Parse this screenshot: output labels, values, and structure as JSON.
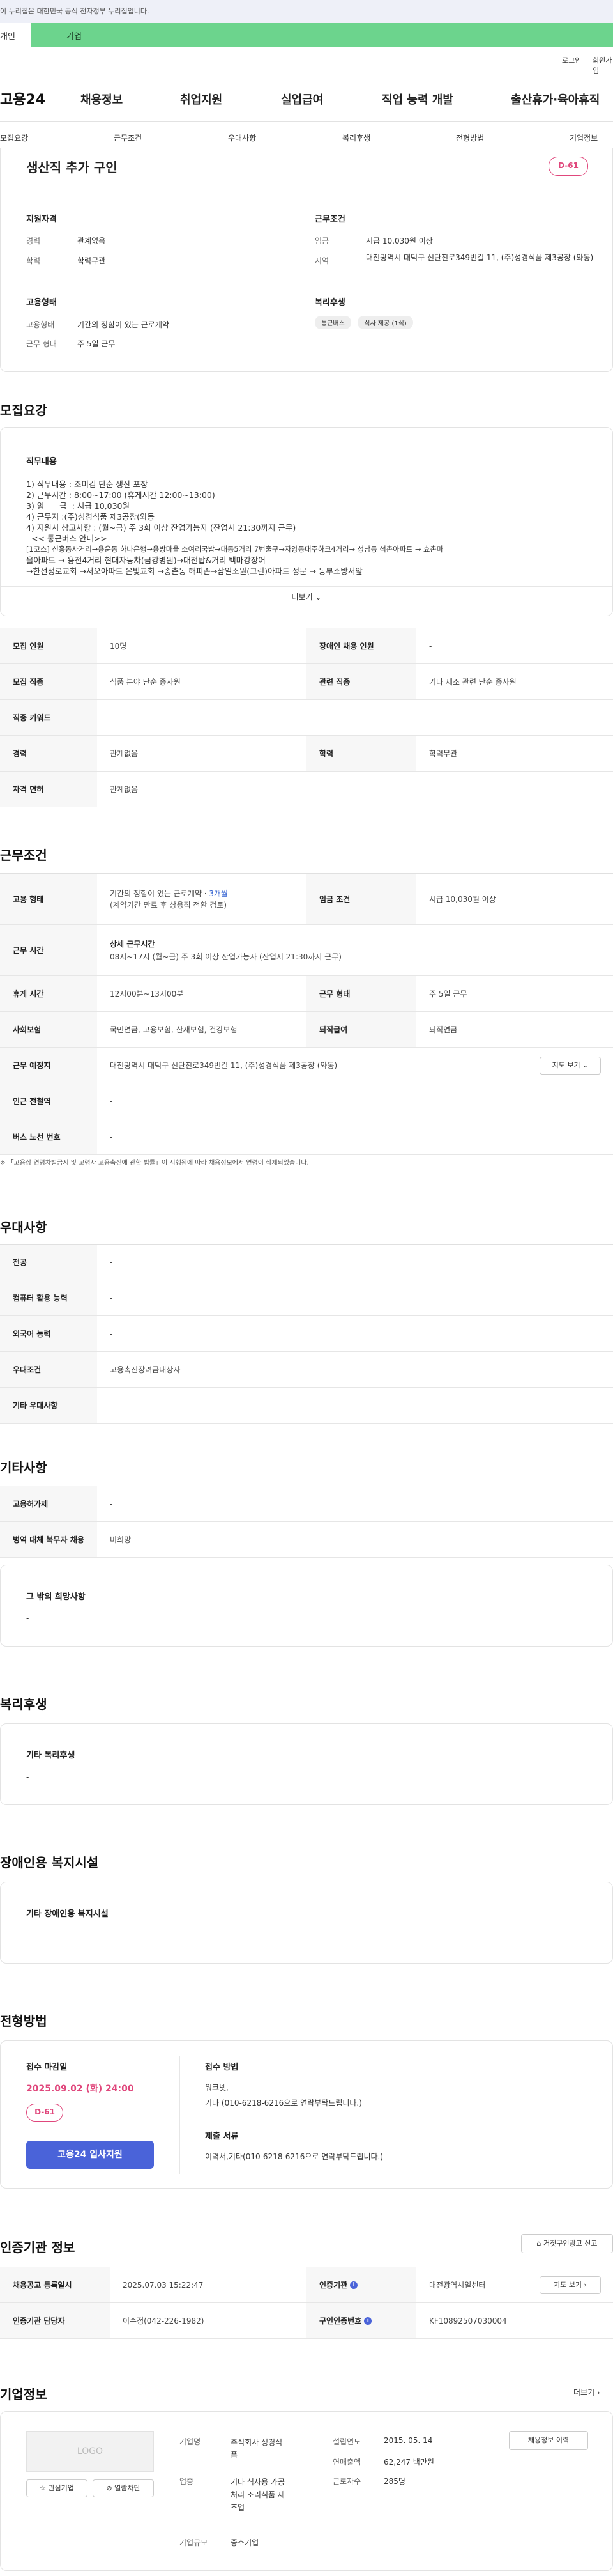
{
  "gov_banner": "이 누리집은 대한민국 공식 전자정부 누리집입니다.",
  "user_tabs": [
    "개인",
    "기업"
  ],
  "util_links": [
    "로그인",
    "회원가입"
  ],
  "logo": "고용24",
  "gnb": [
    "채용정보",
    "취업지원",
    "실업급여",
    "직업 능력 개발",
    "출산휴가·육아휴직"
  ],
  "subnav": [
    "모집요강",
    "근무조건",
    "우대사항",
    "복리후생",
    "전형방법",
    "기업정보"
  ],
  "job": {
    "title": "생산직 추가 구인",
    "dday": "D-61",
    "qual_title": "지원자격",
    "career_label": "경력",
    "career": "관계없음",
    "edu_label": "학력",
    "edu": "학력무관",
    "emp_title": "고용형태",
    "emptype_label": "고용형태",
    "emptype": "기간의 정함이 있는 근로계약",
    "week_label": "근무 형태",
    "week": "주 5일 근무",
    "cond_title": "근무조건",
    "wage_label": "임금",
    "wage": "시급 10,030원 이상",
    "region_label": "지역",
    "region": "대전광역시 대덕구 신탄진로349번길 11, (주)성경식품 제3공장 (와동)",
    "welfare_title": "복리후생",
    "welfare_chips": [
      "통근버스",
      "식사 제공 (1식)"
    ]
  },
  "recruit": {
    "title": "모집요강",
    "duty_title": "직무내용",
    "duty_lines": [
      "1) 직무내용 : 조미김 단순 생산 포장",
      "2) 근무시간 : 8:00~17:00 (휴게시간 12:00~13:00)",
      "3) 임      금  : 시급 10,030원",
      "4) 근무지 :(주)성경식품 제3공장(와동",
      "4) 지원시 참고사항 : (월~금) 주 3회 이상 잔업가능자 (잔업시 21:30까지 근무)",
      "  << 통근버스 안내>>",
      "[1코스] 신흥동사거리→용운동 하나은행→용방마을 소여리국밥→대동5거리 7번출구→자양동대주하크4거리→ 성남동 석촌아파트 → 효촌마",
      "을아파트 → 용전4거리 현대자동차(금강병원)→대전탑&거리 백마강장어",
      "→한선정로교회 →서오아파트 은빛교회 →송촌동 해피존→삼일소원(그린)아파트 정문 → 동부소방서앞"
    ],
    "more": "더보기",
    "rows": [
      [
        {
          "k": "모집 인원",
          "v": "10명"
        },
        {
          "k": "장애인 채용 인원",
          "v": "-"
        }
      ],
      [
        {
          "k": "모집 직종",
          "v": "식품 분야 단순 종사원"
        },
        {
          "k": "관련 직종",
          "v": "기타 제조 관련 단순 종사원"
        }
      ],
      [
        {
          "k": "직종 키워드",
          "v": "-"
        }
      ],
      [
        {
          "k": "경력",
          "v": "관계없음"
        },
        {
          "k": "학력",
          "v": "학력무관"
        }
      ],
      [
        {
          "k": "자격 면허",
          "v": "관계없음"
        }
      ]
    ]
  },
  "work": {
    "title": "근무조건",
    "emp_k": "고용 형태",
    "emp_v1": "기간의 정함이 있는 근로계약 · ",
    "emp_v1_hl": "3개월",
    "emp_v2": "(계약기간 만료 후 상용직 전환 검토)",
    "wagecond_k": "임금 조건",
    "wagecond_v": "시급 10,030원 이상",
    "hours_k": "근무 시간",
    "hours_v1": "상세 근무시간",
    "hours_v2": "08시~17시 (월~금) 주 3회 이상 잔업가능자 (잔업시 21:30까지 근무)",
    "rest_k": "휴게 시간",
    "rest_v": "12시00분~13시00분",
    "type_k": "근무 형태",
    "type_v": "주 5일 근무",
    "ins_k": "사회보험",
    "ins_v": "국민연금, 고용보험, 산재보험, 건강보험",
    "sev_k": "퇴직급여",
    "sev_v": "퇴직연금",
    "place_k": "근무 예정지",
    "place_v": "대전광역시 대덕구 신탄진로349번길 11, (주)성경식품 제3공장 (와동)",
    "map_btn": "지도 보기",
    "subway_k": "인근 전철역",
    "subway_v": "-",
    "bus_k": "버스 노선 번호",
    "bus_v": "-",
    "note": "※ 「고용상 연령차별금지 및 고령자 고용촉진에 관한 법률」이 시행됨에 따라 채용정보에서 연령이 삭제되었습니다."
  },
  "pref": {
    "title": "우대사항",
    "rows": [
      {
        "k": "전공",
        "v": "-"
      },
      {
        "k": "컴퓨터 활용 능력",
        "v": "-"
      },
      {
        "k": "외국어 능력",
        "v": "-"
      },
      {
        "k": "우대조건",
        "v": "고용촉진장려금대상자"
      },
      {
        "k": "기타 우대사항",
        "v": "-"
      }
    ]
  },
  "etc": {
    "title": "기타사항",
    "rows": [
      {
        "k": "고용허가제",
        "v": "-"
      },
      {
        "k": "병역 대체 복무자 채용",
        "v": "비희망"
      }
    ],
    "wish_title": "그 밖의 희망사항",
    "wish_v": "-"
  },
  "welfare": {
    "title": "복리후생",
    "box_title": "기타 복리후생",
    "box_v": "-"
  },
  "disability": {
    "title": "장애인용 복지시설",
    "box_title": "기타 장애인용 복지시설",
    "box_v": "-"
  },
  "screen": {
    "title": "전형방법",
    "deadline_title": "접수 마감일",
    "deadline": "2025.09.02 (화) 24:00",
    "dday": "D-61",
    "apply_btn": "고용24 입사지원",
    "method_title": "접수 방법",
    "method1": "워크넷,",
    "method2": "기타 (010-6218-6216으로 연락부탁드립니다.)",
    "docs_title": "제출 서류",
    "docs": "이력서,기타(010-6218-6216으로 연락부탁드립니다.)"
  },
  "cert": {
    "title": "인증기관 정보",
    "report_btn": "거짓구인광고 신고",
    "row1": [
      {
        "k": "채용공고 등록일시",
        "v": "2025.07.03 15:22:47"
      },
      {
        "k": "인증기관",
        "v": "대전광역시일센터"
      }
    ],
    "row2": [
      {
        "k": "인증기관 담당자",
        "v": "이수정(042-226-1982)"
      },
      {
        "k": "구인인증번호",
        "v": "KF10892507030004"
      }
    ],
    "map_btn": "지도 보기"
  },
  "company": {
    "title": "기업정보",
    "more": "더보기",
    "logo": "LOGO",
    "fav_btn": "관심기업",
    "block_btn": "열람차단",
    "name_k": "기업명",
    "name_v1": "주식회사 성경식",
    "name_v2": "품",
    "industry_k": "업종",
    "industry_v1": "기타 식사용 가공",
    "industry_v2": "처리 조리식품 제",
    "industry_v3": "조업",
    "size_k": "기업규모",
    "size_v": "중소기업",
    "est_k": "설립연도",
    "est_v": "2015. 05. 14",
    "sales_k": "연매출액",
    "sales_v": "62,247 백만원",
    "emp_k": "근로자수",
    "emp_v": "285명",
    "jobs_btn": "채용정보 이력"
  }
}
